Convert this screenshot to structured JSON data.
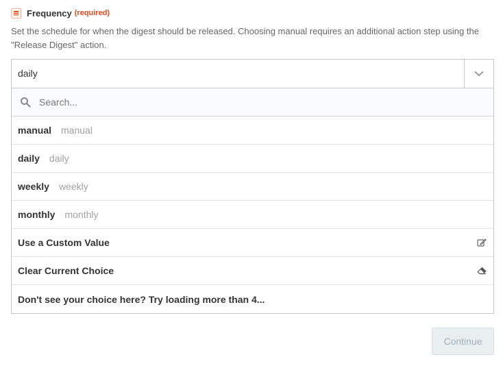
{
  "field": {
    "label": "Frequency",
    "required_text": "(required)",
    "help_text": "Set the schedule for when the digest should be released. Choosing manual requires an additional action step using the \"Release Digest\" action.",
    "app_icon": "digest-app-icon"
  },
  "select": {
    "value": "daily",
    "toggle_icon": "chevron-down-icon"
  },
  "search": {
    "placeholder": "Search...",
    "icon": "search-icon"
  },
  "options": [
    {
      "label": "manual",
      "value": "manual"
    },
    {
      "label": "daily",
      "value": "daily"
    },
    {
      "label": "weekly",
      "value": "weekly"
    },
    {
      "label": "monthly",
      "value": "monthly"
    }
  ],
  "actions": {
    "custom_value": {
      "label": "Use a Custom Value",
      "icon": "edit-icon"
    },
    "clear_choice": {
      "label": "Clear Current Choice",
      "icon": "eraser-icon"
    },
    "load_more": {
      "label": "Don't see your choice here? Try loading more than 4..."
    }
  },
  "buttons": {
    "continue_label": "Continue"
  },
  "colors": {
    "required": "#e8491d",
    "continue_bg": "#e9eff1",
    "continue_text": "#9fb3bc"
  }
}
